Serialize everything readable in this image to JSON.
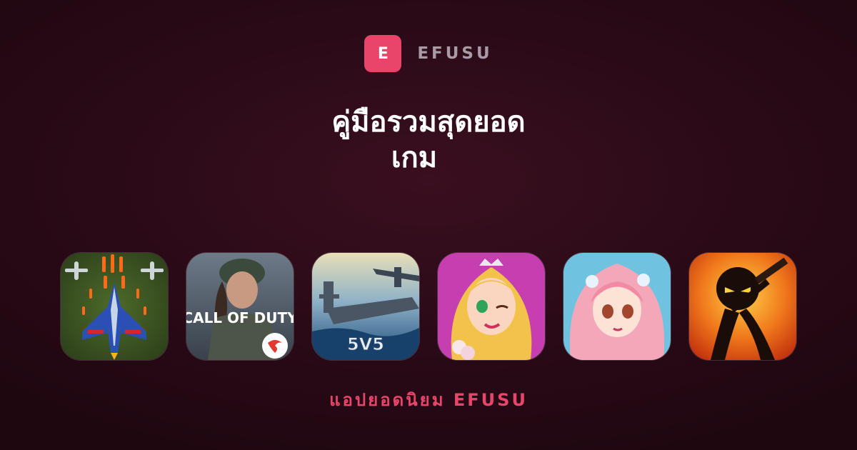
{
  "brand": {
    "logo_letter": "E",
    "name": "EFUSU",
    "accent": "#e9456a"
  },
  "title": {
    "line1": "คู่มือรวมสุดยอด",
    "line2": "เกม"
  },
  "apps": [
    {
      "name": "air-fighter-game-icon",
      "label": ""
    },
    {
      "name": "call-of-duty-icon",
      "label": "CALL OF DUTY"
    },
    {
      "name": "warship-5v5-icon",
      "label": "5V5"
    },
    {
      "name": "princess-dressup-icon",
      "label": ""
    },
    {
      "name": "anime-bride-icon",
      "label": ""
    },
    {
      "name": "stickman-fire-icon",
      "label": ""
    }
  ],
  "footer": "แอปยอดนิยม EFUSU"
}
